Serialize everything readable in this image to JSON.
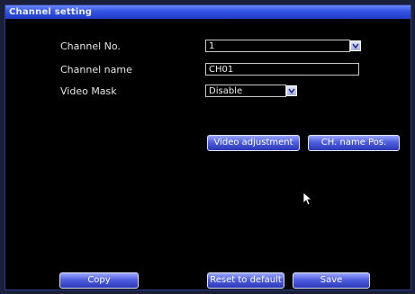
{
  "window": {
    "title": "Channel setting"
  },
  "form": {
    "channel_no_label": "Channel No.",
    "channel_no_value": "1",
    "channel_name_label": "Channel name",
    "channel_name_value": "CH01",
    "video_mask_label": "Video Mask",
    "video_mask_value": "Disable"
  },
  "buttons": {
    "video_adjustment": "Video adjustment",
    "ch_name_pos": "CH.  name Pos.",
    "copy": "Copy",
    "reset_default": "Reset to default",
    "save": "Save"
  },
  "icons": {
    "dropdown": "chevron-down-icon",
    "cursor": "mouse-pointer-icon"
  },
  "colors": {
    "titlebar": "#3656e6",
    "button": "#4f5fe0",
    "background": "#000000"
  }
}
